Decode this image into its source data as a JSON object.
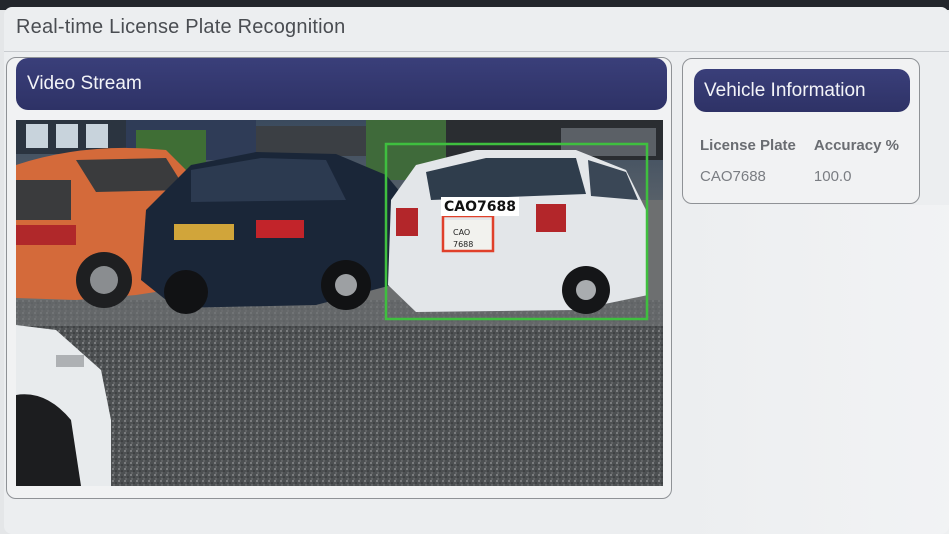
{
  "app": {
    "title": "Real-time License Plate Recognition"
  },
  "video_panel": {
    "header": "Video Stream",
    "detection": {
      "plate_label": "CAO7688"
    }
  },
  "info_panel": {
    "header": "Vehicle Information",
    "columns": [
      "License Plate",
      "Accuracy %"
    ],
    "rows": [
      {
        "plate": "CAO7688",
        "accuracy": "100.0"
      }
    ]
  },
  "colors": {
    "header_bar": "#2e3266",
    "detection_box": "#3fbf3f",
    "plate_box": "#e0402a"
  }
}
